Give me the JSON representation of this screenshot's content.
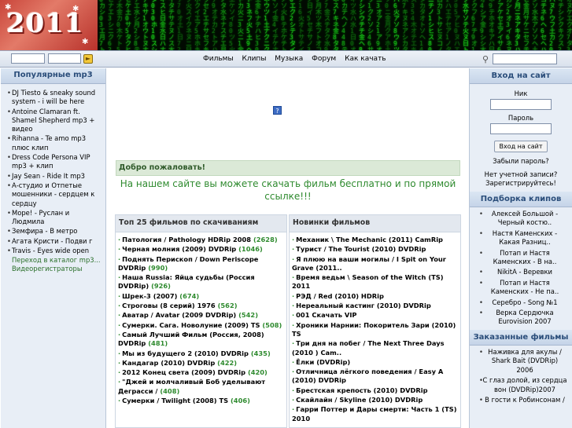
{
  "header": {
    "logo_text": "2011"
  },
  "nav": {
    "menu": [
      "Фильмы",
      "Клипы",
      "Музыка",
      "Форум",
      "Как качать"
    ]
  },
  "left": {
    "title": "Популярные mp3",
    "items": [
      "DJ Tiesto & sneaky sound system - i will be here",
      "Antoine Clamaran ft. Shamel Shepherd mp3 + видео",
      "Rihanna - Te amo mp3 плюс клип",
      "Dress Code Persona VIP mp3 + клип",
      "Jay Sean - Ride It mp3",
      "А-студио и Отпетые мошенники - сердцем к сердцу",
      "Море! - Руслан и Людмила",
      "Земфира - В метро",
      "Агата Кристи - Подви г",
      "Travis - Eyes wide open"
    ],
    "links": [
      "Переход в каталог mp3...",
      "Видеорегистраторы"
    ]
  },
  "main": {
    "welcome_title": "Добро пожаловать!",
    "welcome_text": "На нашем сайте вы можете скачать фильм бесплатно и по прямой ссылке!!!",
    "top_title": "Топ 25 фильмов по скачиваниям",
    "new_title": "Новинки фильмов",
    "top": [
      {
        "name": "Патология / Pathology HDRip 2008",
        "count": "(2628)"
      },
      {
        "name": "Черная молния (2009) DVDRip",
        "count": "(1046)"
      },
      {
        "name": "Поднять Перископ / Down Periscope DVDRip",
        "count": "(990)"
      },
      {
        "name": "Наша Russia: Яйца судьбы (Россия DVDRip)",
        "count": "(926)"
      },
      {
        "name": "Шрек-3 (2007)",
        "count": "(674)"
      },
      {
        "name": "Строговы (8 серий) 1976",
        "count": "(562)"
      },
      {
        "name": "Аватар / Avatar (2009 DVDRip)",
        "count": "(542)"
      },
      {
        "name": "Сумерки. Сага. Новолуние (2009) TS",
        "count": "(508)"
      },
      {
        "name": "Самый Лучший Фильм (Россия, 2008) DVDRip",
        "count": "(481)"
      },
      {
        "name": "Мы из будущего 2 (2010) DVDRip",
        "count": "(435)"
      },
      {
        "name": "Кандагар (2010) DVDRip",
        "count": "(422)"
      },
      {
        "name": "2012 Конец света (2009) DVDRip",
        "count": "(420)"
      },
      {
        "name": "\"Джей и молчаливый Боб уделывают Деграсси /",
        "count": "(408)"
      },
      {
        "name": "Сумерки / Twilight (2008) TS",
        "count": "(406)"
      }
    ],
    "new": [
      "Механик \\ The Mechanic (2011) CamRip",
      "Турист / The Tourist (2010) DVDRip",
      "Я плюю на ваши могилы / I Spit on Your Grave (2011..",
      "Время ведьм \\ Season of the Witch (TS) 2011",
      "РЭД / Red (2010) HDRip",
      "Нереальный кастинг (2010) DVDRip",
      "001 Скачать VIP",
      "Хроники Нарнии: Покоритель Зари (2010) TS",
      "Три дня на побег / The Next Three Days (2010 ) Cam..",
      "Ёлки (DVDRip)",
      "Отличница лёгкого поведения / Easy A (2010) DVDRip",
      "Брестская крепость (2010) DVDRip",
      "Скайлайн / Skyline (2010) DVDRip",
      "Гарри Поттер и Дары смерти: Часть 1 (TS) 2010"
    ]
  },
  "right": {
    "login_title": "Вход на сайт",
    "login_label": "Ник",
    "password_label": "Пароль",
    "login_button": "Вход на сайт",
    "forgot": "Забыли пароль?",
    "noacc": "Нет учетной записи? Зарегистрируйтесь!",
    "clips_title": "Подборка клипов",
    "clips": [
      "Алексей Большой - Черный костю..",
      "Настя Каменских - Какая Разниц..",
      "Потап и Настя Каменских - В на..",
      "NikitA - Веревки",
      "Потап и Настя Каменских - Не па..",
      "Серебро - Song №1",
      "Верка Сердючка Eurovision 2007"
    ],
    "ordered_title": "Заказанные фильмы",
    "ordered": [
      "Наживка для акулы / Shark Bait (DVDRip) 2006",
      "С глаз долой, из сердца вон (DVDRip)2007",
      "В гости к Робинсонам /"
    ]
  }
}
